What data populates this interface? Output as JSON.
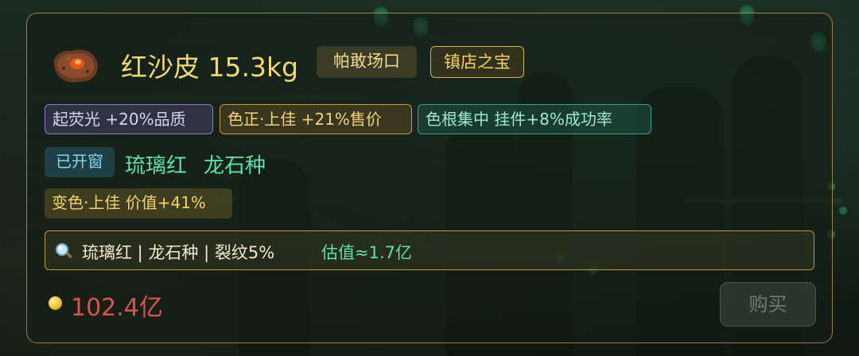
{
  "item": {
    "title": "红沙皮 15.3kg",
    "origin": "帕敢场口",
    "rarity": "镇店之宝",
    "icon": "rough-stone-icon"
  },
  "attributes": [
    {
      "label": "起荧光 +20%品质",
      "color": "#8b7bc2"
    },
    {
      "label": "色正·上佳 +21%售价",
      "color": "#c89a3e"
    },
    {
      "label": "色根集中 挂件+8%成功率",
      "color": "#3f9c86"
    }
  ],
  "opened": {
    "status": "已开窗",
    "jade_color": "琉璃红",
    "jade_type": "龙石种"
  },
  "color_change": "变色·上佳 价值+41%",
  "inspection": {
    "icon": "magnifier-icon",
    "summary": "琉璃红 | 龙石种 | 裂纹5%",
    "estimate": "估值≈1.7亿"
  },
  "price": {
    "icon": "gold-coin-icon",
    "value": "102.4亿"
  },
  "buy_button": {
    "label": "购买",
    "state": "disabled"
  }
}
